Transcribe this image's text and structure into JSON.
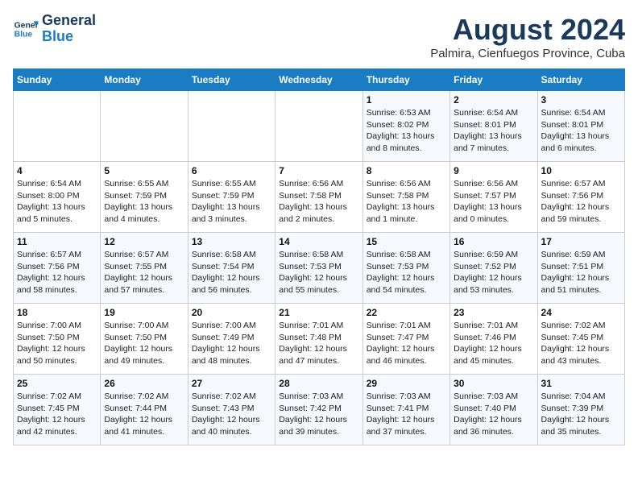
{
  "logo": {
    "line1": "General",
    "line2": "Blue"
  },
  "title": "August 2024",
  "subtitle": "Palmira, Cienfuegos Province, Cuba",
  "days_of_week": [
    "Sunday",
    "Monday",
    "Tuesday",
    "Wednesday",
    "Thursday",
    "Friday",
    "Saturday"
  ],
  "weeks": [
    [
      {
        "day": "",
        "info": ""
      },
      {
        "day": "",
        "info": ""
      },
      {
        "day": "",
        "info": ""
      },
      {
        "day": "",
        "info": ""
      },
      {
        "day": "1",
        "info": "Sunrise: 6:53 AM\nSunset: 8:02 PM\nDaylight: 13 hours\nand 8 minutes."
      },
      {
        "day": "2",
        "info": "Sunrise: 6:54 AM\nSunset: 8:01 PM\nDaylight: 13 hours\nand 7 minutes."
      },
      {
        "day": "3",
        "info": "Sunrise: 6:54 AM\nSunset: 8:01 PM\nDaylight: 13 hours\nand 6 minutes."
      }
    ],
    [
      {
        "day": "4",
        "info": "Sunrise: 6:54 AM\nSunset: 8:00 PM\nDaylight: 13 hours\nand 5 minutes."
      },
      {
        "day": "5",
        "info": "Sunrise: 6:55 AM\nSunset: 7:59 PM\nDaylight: 13 hours\nand 4 minutes."
      },
      {
        "day": "6",
        "info": "Sunrise: 6:55 AM\nSunset: 7:59 PM\nDaylight: 13 hours\nand 3 minutes."
      },
      {
        "day": "7",
        "info": "Sunrise: 6:56 AM\nSunset: 7:58 PM\nDaylight: 13 hours\nand 2 minutes."
      },
      {
        "day": "8",
        "info": "Sunrise: 6:56 AM\nSunset: 7:58 PM\nDaylight: 13 hours\nand 1 minute."
      },
      {
        "day": "9",
        "info": "Sunrise: 6:56 AM\nSunset: 7:57 PM\nDaylight: 13 hours\nand 0 minutes."
      },
      {
        "day": "10",
        "info": "Sunrise: 6:57 AM\nSunset: 7:56 PM\nDaylight: 12 hours\nand 59 minutes."
      }
    ],
    [
      {
        "day": "11",
        "info": "Sunrise: 6:57 AM\nSunset: 7:56 PM\nDaylight: 12 hours\nand 58 minutes."
      },
      {
        "day": "12",
        "info": "Sunrise: 6:57 AM\nSunset: 7:55 PM\nDaylight: 12 hours\nand 57 minutes."
      },
      {
        "day": "13",
        "info": "Sunrise: 6:58 AM\nSunset: 7:54 PM\nDaylight: 12 hours\nand 56 minutes."
      },
      {
        "day": "14",
        "info": "Sunrise: 6:58 AM\nSunset: 7:53 PM\nDaylight: 12 hours\nand 55 minutes."
      },
      {
        "day": "15",
        "info": "Sunrise: 6:58 AM\nSunset: 7:53 PM\nDaylight: 12 hours\nand 54 minutes."
      },
      {
        "day": "16",
        "info": "Sunrise: 6:59 AM\nSunset: 7:52 PM\nDaylight: 12 hours\nand 53 minutes."
      },
      {
        "day": "17",
        "info": "Sunrise: 6:59 AM\nSunset: 7:51 PM\nDaylight: 12 hours\nand 51 minutes."
      }
    ],
    [
      {
        "day": "18",
        "info": "Sunrise: 7:00 AM\nSunset: 7:50 PM\nDaylight: 12 hours\nand 50 minutes."
      },
      {
        "day": "19",
        "info": "Sunrise: 7:00 AM\nSunset: 7:50 PM\nDaylight: 12 hours\nand 49 minutes."
      },
      {
        "day": "20",
        "info": "Sunrise: 7:00 AM\nSunset: 7:49 PM\nDaylight: 12 hours\nand 48 minutes."
      },
      {
        "day": "21",
        "info": "Sunrise: 7:01 AM\nSunset: 7:48 PM\nDaylight: 12 hours\nand 47 minutes."
      },
      {
        "day": "22",
        "info": "Sunrise: 7:01 AM\nSunset: 7:47 PM\nDaylight: 12 hours\nand 46 minutes."
      },
      {
        "day": "23",
        "info": "Sunrise: 7:01 AM\nSunset: 7:46 PM\nDaylight: 12 hours\nand 45 minutes."
      },
      {
        "day": "24",
        "info": "Sunrise: 7:02 AM\nSunset: 7:45 PM\nDaylight: 12 hours\nand 43 minutes."
      }
    ],
    [
      {
        "day": "25",
        "info": "Sunrise: 7:02 AM\nSunset: 7:45 PM\nDaylight: 12 hours\nand 42 minutes."
      },
      {
        "day": "26",
        "info": "Sunrise: 7:02 AM\nSunset: 7:44 PM\nDaylight: 12 hours\nand 41 minutes."
      },
      {
        "day": "27",
        "info": "Sunrise: 7:02 AM\nSunset: 7:43 PM\nDaylight: 12 hours\nand 40 minutes."
      },
      {
        "day": "28",
        "info": "Sunrise: 7:03 AM\nSunset: 7:42 PM\nDaylight: 12 hours\nand 39 minutes."
      },
      {
        "day": "29",
        "info": "Sunrise: 7:03 AM\nSunset: 7:41 PM\nDaylight: 12 hours\nand 37 minutes."
      },
      {
        "day": "30",
        "info": "Sunrise: 7:03 AM\nSunset: 7:40 PM\nDaylight: 12 hours\nand 36 minutes."
      },
      {
        "day": "31",
        "info": "Sunrise: 7:04 AM\nSunset: 7:39 PM\nDaylight: 12 hours\nand 35 minutes."
      }
    ]
  ]
}
